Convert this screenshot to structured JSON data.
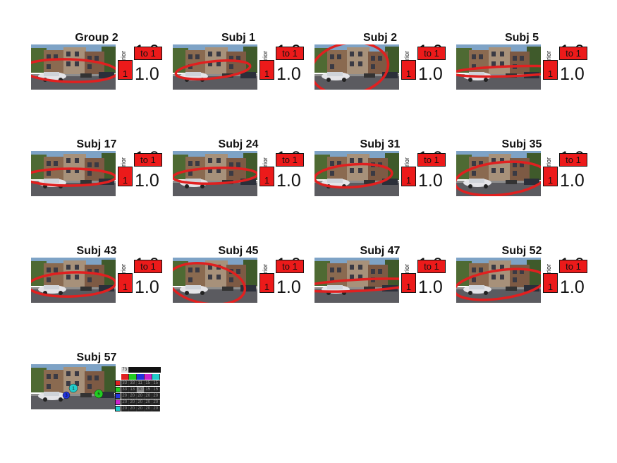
{
  "panels": [
    {
      "title": "Group 2",
      "prior_label": "prior",
      "top_value": "1.0",
      "bottom_value": "1.0",
      "to_label": "to 1",
      "one_label": "1"
    },
    {
      "title": "Subj 1",
      "prior_label": "prior",
      "top_value": "1.0",
      "bottom_value": "1.0",
      "to_label": "to 1",
      "one_label": "1"
    },
    {
      "title": "Subj 2",
      "prior_label": "prior",
      "top_value": "1.0",
      "bottom_value": "1.0",
      "to_label": "to 1",
      "one_label": "1"
    },
    {
      "title": "Subj 5",
      "prior_label": "prior",
      "top_value": "1.0",
      "bottom_value": "1.0",
      "to_label": "to 1",
      "one_label": "1"
    },
    {
      "title": "Subj 17",
      "prior_label": "prior",
      "top_value": "1.0",
      "bottom_value": "1.0",
      "to_label": "to 1",
      "one_label": "1"
    },
    {
      "title": "Subj 24",
      "prior_label": "prior",
      "top_value": "1.0",
      "bottom_value": "1.0",
      "to_label": "to 1",
      "one_label": "1"
    },
    {
      "title": "Subj 31",
      "prior_label": "prior",
      "top_value": "1.0",
      "bottom_value": "1.0",
      "to_label": "to 1",
      "one_label": "1"
    },
    {
      "title": "Subj 35",
      "prior_label": "prior",
      "top_value": "1.0",
      "bottom_value": "1.0",
      "to_label": "to 1",
      "one_label": "1"
    },
    {
      "title": "Subj 43",
      "prior_label": "prior",
      "top_value": "1.0",
      "bottom_value": "1.0",
      "to_label": "to 1",
      "one_label": "1"
    },
    {
      "title": "Subj 45",
      "prior_label": "prior",
      "top_value": "1.0",
      "bottom_value": "1.0",
      "to_label": "to 1",
      "one_label": "1"
    },
    {
      "title": "Subj 47",
      "prior_label": "prior",
      "top_value": "1.0",
      "bottom_value": "1.0",
      "to_label": "to 1",
      "one_label": "1"
    },
    {
      "title": "Subj 52",
      "prior_label": "prior",
      "top_value": "1.0",
      "bottom_value": "1.0",
      "to_label": "to 1",
      "one_label": "1"
    }
  ],
  "last_panel": {
    "title": "Subj 57",
    "header_value": "73",
    "matrix_rows": [
      [
        "33",
        "33",
        "11",
        "15",
        "15"
      ],
      [
        "33",
        "13",
        "30",
        "15",
        "15"
      ],
      [
        "20",
        "20",
        "20",
        "20",
        "20"
      ],
      [
        "20",
        "20",
        "20",
        "20",
        "20"
      ],
      [
        "20",
        "20",
        "20",
        "20",
        "20"
      ]
    ],
    "marker_labels": [
      "1",
      "3",
      "5"
    ]
  },
  "colors": {
    "ellipse": "#e02020",
    "box_fill": "#ec1a1a",
    "matrix_bg": "#1e1e1e",
    "cluster_colors": [
      "#e02020",
      "#22cc22",
      "#2233dd",
      "#cc22cc",
      "#22cccc"
    ]
  }
}
